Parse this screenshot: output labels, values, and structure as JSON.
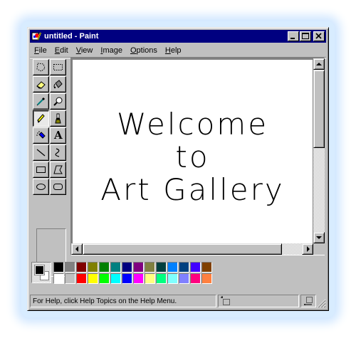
{
  "window": {
    "title": "untitled - Paint",
    "app_icon": "paint-icon",
    "controls": [
      "minimize-icon",
      "maximize-icon",
      "close-icon"
    ]
  },
  "menubar": {
    "items": [
      {
        "label": "File",
        "mnemonic": "F",
        "rest": "ile"
      },
      {
        "label": "Edit",
        "mnemonic": "E",
        "rest": "dit"
      },
      {
        "label": "View",
        "mnemonic": "V",
        "rest": "iew"
      },
      {
        "label": "Image",
        "mnemonic": "I",
        "rest": "mage"
      },
      {
        "label": "Options",
        "mnemonic": "O",
        "rest": "ptions"
      },
      {
        "label": "Help",
        "mnemonic": "H",
        "rest": "elp"
      }
    ]
  },
  "toolbox": {
    "tools": [
      {
        "name": "free-form-select-icon",
        "selected": false
      },
      {
        "name": "rectangle-select-icon",
        "selected": false
      },
      {
        "name": "eraser-icon",
        "selected": false
      },
      {
        "name": "fill-bucket-icon",
        "selected": false
      },
      {
        "name": "color-picker-icon",
        "selected": false
      },
      {
        "name": "magnifier-icon",
        "selected": false
      },
      {
        "name": "pencil-icon",
        "selected": true
      },
      {
        "name": "brush-icon",
        "selected": false
      },
      {
        "name": "airbrush-icon",
        "selected": false
      },
      {
        "name": "text-tool-icon",
        "selected": false
      },
      {
        "name": "line-icon",
        "selected": false
      },
      {
        "name": "curve-icon",
        "selected": false
      },
      {
        "name": "rectangle-icon",
        "selected": false
      },
      {
        "name": "polygon-icon",
        "selected": false
      },
      {
        "name": "ellipse-icon",
        "selected": false
      },
      {
        "name": "rounded-rectangle-icon",
        "selected": false
      }
    ],
    "text_tool_glyph": "A"
  },
  "canvas": {
    "lines": [
      "Welcome",
      "to",
      "Art Gallery"
    ]
  },
  "palette": {
    "foreground": "#000000",
    "background": "#ffffff",
    "row1": [
      "#000000",
      "#808080",
      "#800000",
      "#808000",
      "#008000",
      "#008080",
      "#000080",
      "#800080",
      "#808040",
      "#004040",
      "#0080ff",
      "#004080",
      "#4000ff",
      "#804000"
    ],
    "row2": [
      "#ffffff",
      "#c0c0c0",
      "#ff0000",
      "#ffff00",
      "#00ff00",
      "#00ffff",
      "#0000ff",
      "#ff00ff",
      "#ffff80",
      "#00ff80",
      "#80ffff",
      "#8080ff",
      "#ff0080",
      "#ff8040"
    ]
  },
  "statusbar": {
    "help_text": "For Help, click Help Topics on the Help Menu.",
    "position_icon": "cursor-position-icon",
    "size_icon": "selection-size-icon"
  }
}
